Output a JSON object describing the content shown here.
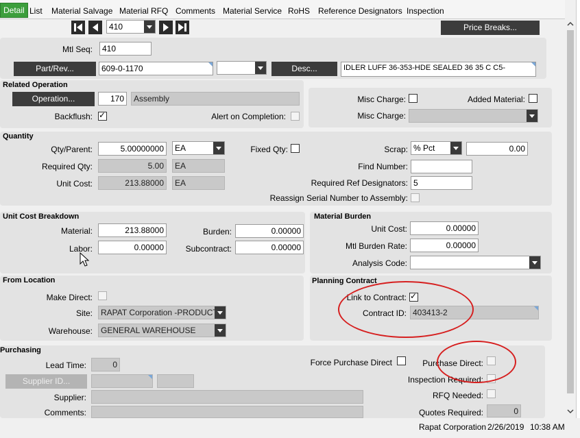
{
  "tabs": [
    "Detail",
    "List",
    "Material Salvage",
    "Material RFQ",
    "Comments",
    "Material Service",
    "RoHS",
    "Reference Designators",
    "Inspection"
  ],
  "nav": {
    "record": "410",
    "price_breaks": "Price Breaks..."
  },
  "header": {
    "mtl_seq_label": "Mtl Seq:",
    "mtl_seq": "410",
    "part_rev_btn": "Part/Rev...",
    "part": "609-0-1170",
    "desc_btn": "Desc...",
    "desc": "IDLER LUFF 36-353-HDE  SEALED 36  35  C C5-"
  },
  "related_operation": {
    "title": "Related Operation",
    "operation_btn": "Operation...",
    "op_num": "170",
    "op_desc": "Assembly",
    "backflush_label": "Backflush:",
    "alert_label": "Alert on Completion:",
    "misc_charge_label": "Misc Charge:",
    "added_material_label": "Added Material:",
    "misc_charge_label2": "Misc Charge:"
  },
  "quantity": {
    "title": "Quantity",
    "qty_parent_label": "Qty/Parent:",
    "qty_parent": "5.00000000",
    "qty_uom": "EA",
    "fixed_qty_label": "Fixed Qty:",
    "scrap_label": "Scrap:",
    "scrap_type": "% Pct",
    "scrap": "0.00",
    "required_qty_label": "Required Qty:",
    "required_qty": "5.00",
    "required_uom": "EA",
    "find_number_label": "Find Number:",
    "unit_cost_label": "Unit Cost:",
    "unit_cost": "213.88000",
    "unit_cost_uom": "EA",
    "req_ref_label": "Required Ref Designators:",
    "req_ref": "5",
    "reassign_label": "Reassign Serial Number to Assembly:"
  },
  "unit_cost_breakdown": {
    "title": "Unit Cost Breakdown",
    "material_label": "Material:",
    "material": "213.88000",
    "burden_label": "Burden:",
    "burden": "0.00000",
    "labor_label": "Labor:",
    "labor": "0.00000",
    "subcontract_label": "Subcontract:",
    "subcontract": "0.00000"
  },
  "material_burden": {
    "title": "Material Burden",
    "unit_cost_label": "Unit Cost:",
    "unit_cost": "0.00000",
    "rate_label": "Mtl  Burden Rate:",
    "rate": "0.00000",
    "analysis_label": "Analysis Code:"
  },
  "from_location": {
    "title": "From Location",
    "make_direct_label": "Make Direct:",
    "site_label": "Site:",
    "site": "RAPAT Corporation -PRODUCT",
    "warehouse_label": "Warehouse:",
    "warehouse": "GENERAL WAREHOUSE"
  },
  "planning_contract": {
    "title": "Planning Contract",
    "link_label": "Link to Contract:",
    "contract_label": "Contract ID:",
    "contract_id": "403413-2"
  },
  "purchasing": {
    "title": "Purchasing",
    "lead_time_label": "Lead Time:",
    "lead_time": "0",
    "supplier_id_btn": "Supplier ID...",
    "supplier_label": "Supplier:",
    "comments_label": "Comments:",
    "force_label": "Force Purchase Direct",
    "purchase_direct_label": "Purchase Direct:",
    "inspection_label": "Inspection  Required:",
    "rfq_label": "RFQ Needed:",
    "quotes_label": "Quotes Required:",
    "quotes": "0"
  },
  "status": {
    "company": "Rapat Corporation",
    "date": "2/26/2019",
    "time": "10:38 AM"
  },
  "colors": {
    "accent": "#3c9e3c",
    "annotation": "#d61f1f"
  }
}
